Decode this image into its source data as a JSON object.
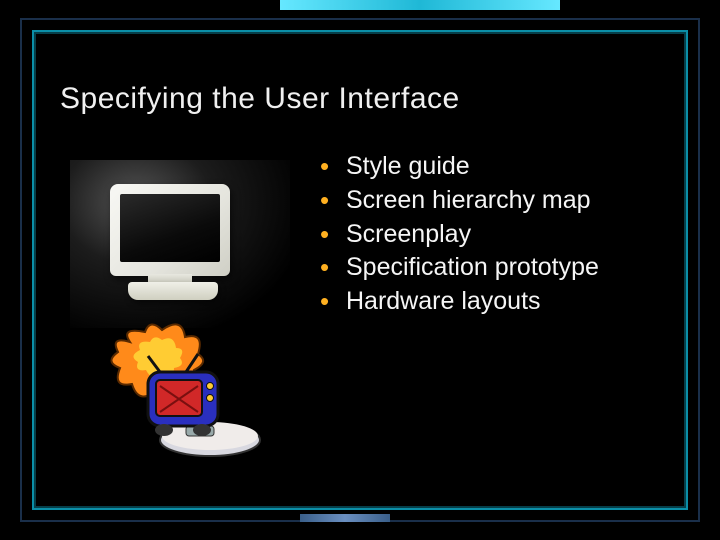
{
  "title": "Specifying the User Interface",
  "bullets": [
    "Style guide",
    "Screen hierarchy map",
    "Screenplay",
    "Specification prototype",
    "Hardware layouts"
  ],
  "accent_colors": {
    "frame": "#0b8fa8",
    "bullet": "#ffb020"
  },
  "illustrations": [
    "crt-monitor-photo",
    "cartoon-tv-fire-roller"
  ]
}
